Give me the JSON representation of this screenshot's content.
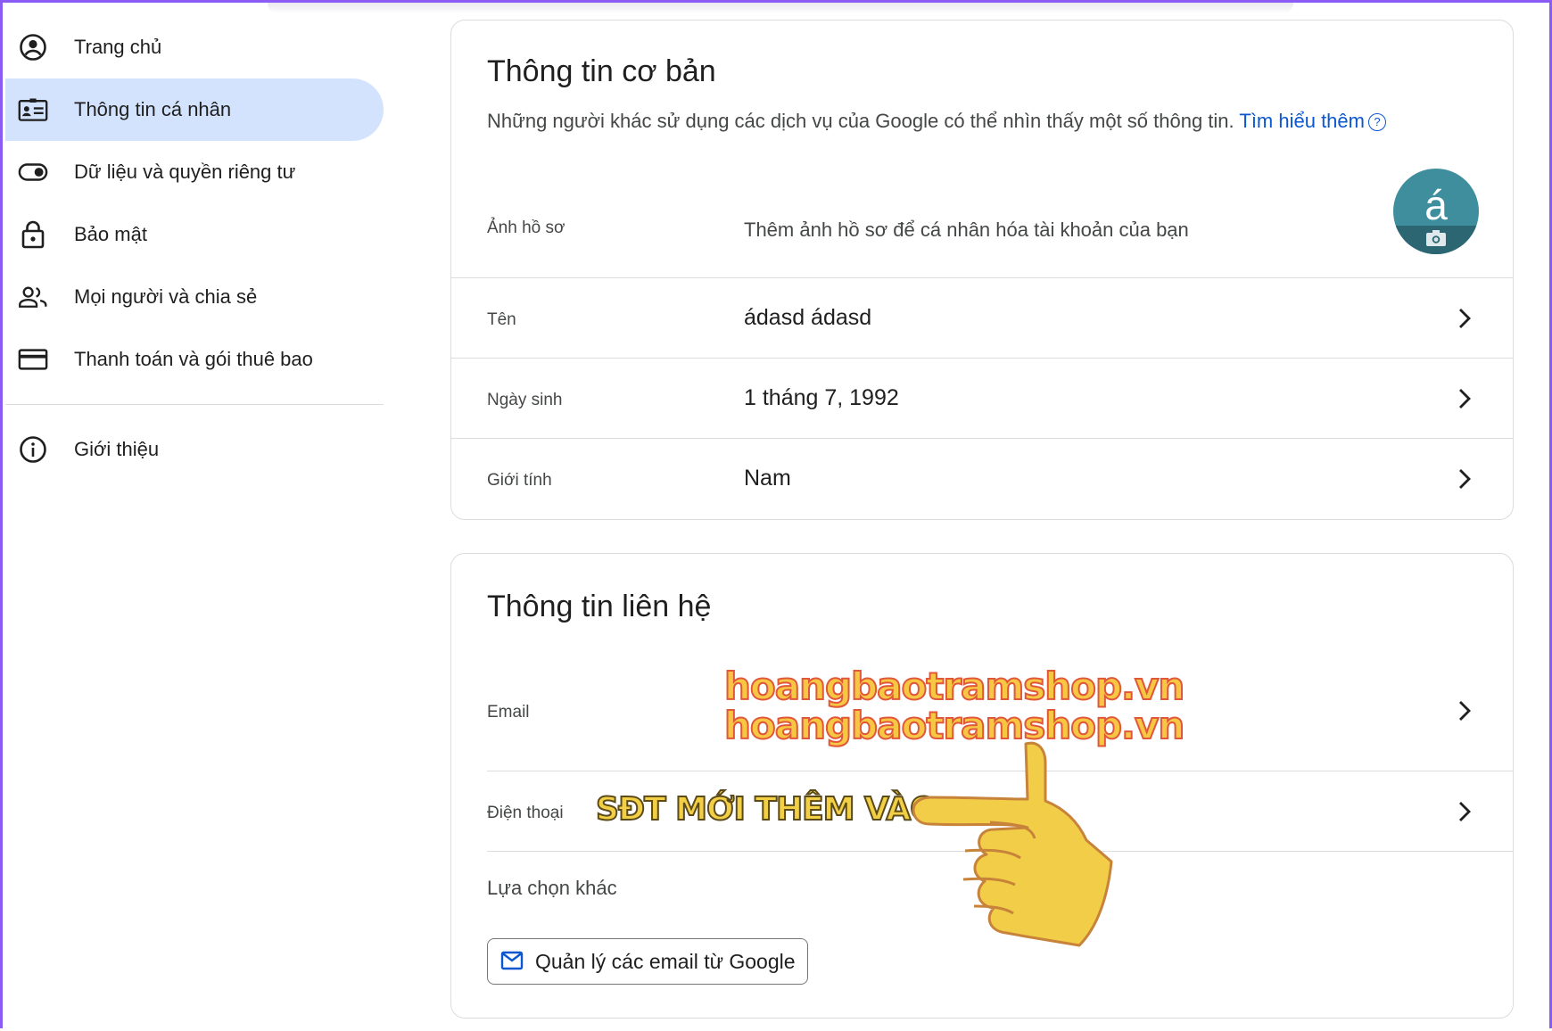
{
  "sidebar": {
    "items": [
      {
        "label": "Trang chủ",
        "icon": "account-circle-icon"
      },
      {
        "label": "Thông tin cá nhân",
        "icon": "id-card-icon",
        "active": true
      },
      {
        "label": "Dữ liệu và quyền riêng tư",
        "icon": "toggle-icon"
      },
      {
        "label": "Bảo mật",
        "icon": "lock-icon"
      },
      {
        "label": "Mọi người và chia sẻ",
        "icon": "people-icon"
      },
      {
        "label": "Thanh toán và gói thuê bao",
        "icon": "credit-card-icon"
      }
    ],
    "about": {
      "label": "Giới thiệu",
      "icon": "info-icon"
    }
  },
  "basic_info": {
    "title": "Thông tin cơ bản",
    "description": "Những người khác sử dụng các dịch vụ của Google có thể nhìn thấy một số thông tin.",
    "learn_more": "Tìm hiểu thêm",
    "photo_label": "Ảnh hồ sơ",
    "photo_hint": "Thêm ảnh hồ sơ để cá nhân hóa tài khoản của bạn",
    "avatar_letter": "á",
    "rows": [
      {
        "label": "Tên",
        "value": "ádasd ádasd"
      },
      {
        "label": "Ngày sinh",
        "value": "1 tháng 7, 1992"
      },
      {
        "label": "Giới tính",
        "value": "Nam"
      }
    ]
  },
  "contact_info": {
    "title": "Thông tin liên hệ",
    "email_label": "Email",
    "phone_label": "Điện thoại",
    "other_options": "Lựa chọn khác",
    "manage_button": "Quản lý các email từ Google"
  },
  "overlay": {
    "watermark_line1": "hoangbaotramshop.vn",
    "watermark_line2": "hoangbaotramshop.vn",
    "annotation": "SĐT MỚI THÊM VÀO"
  },
  "colors": {
    "active_bg": "#d3e3fd",
    "link": "#0b57d0",
    "frame": "#8a5cf5",
    "avatar": "#3f8e9e"
  }
}
